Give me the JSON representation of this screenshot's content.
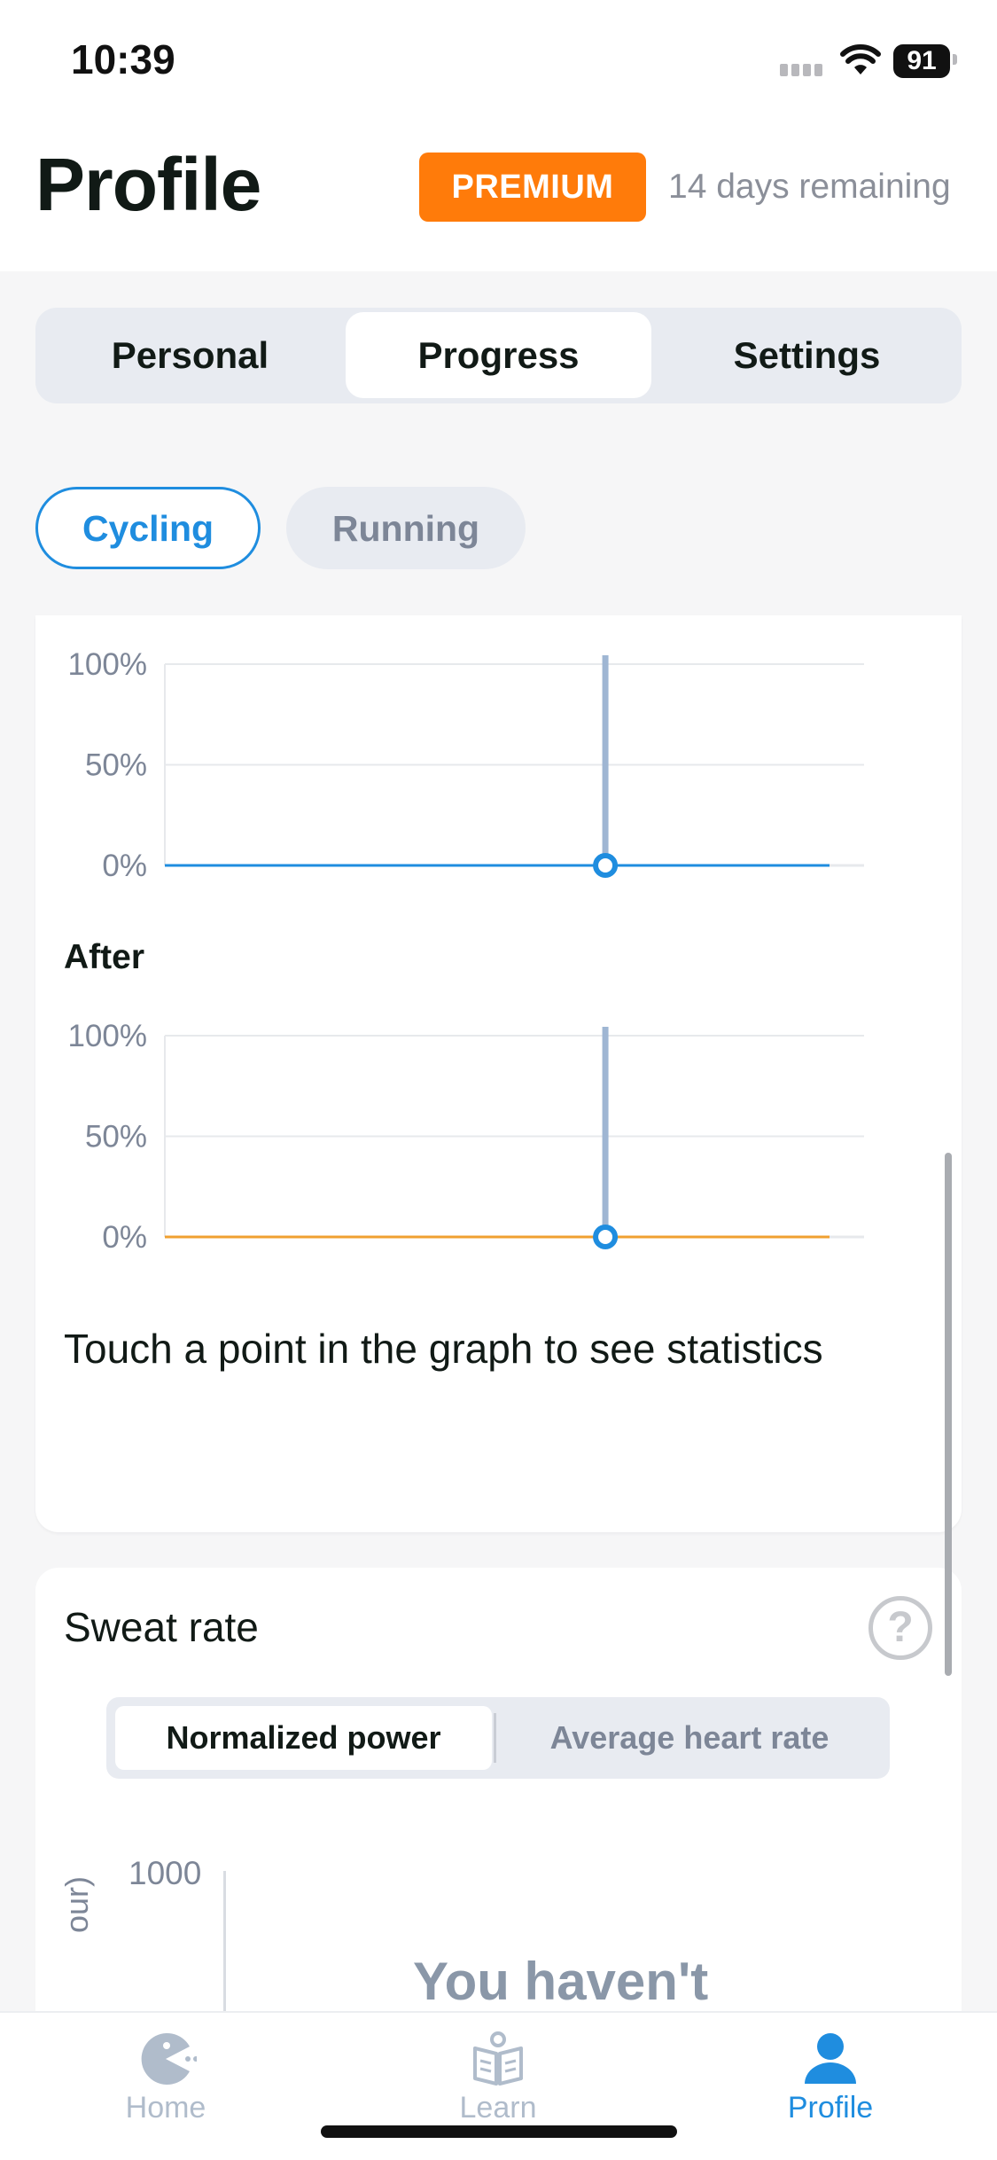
{
  "status_bar": {
    "time": "10:39",
    "battery": "91"
  },
  "header": {
    "title": "Profile",
    "badge": "PREMIUM",
    "remaining": "14 days remaining"
  },
  "tabs": [
    {
      "label": "Personal",
      "active": false
    },
    {
      "label": "Progress",
      "active": true
    },
    {
      "label": "Settings",
      "active": false
    }
  ],
  "sports": [
    {
      "label": "Cycling",
      "active": true
    },
    {
      "label": "Running",
      "active": false
    }
  ],
  "chart_data": [
    {
      "type": "line",
      "title": "",
      "y_ticks": [
        "100%",
        "50%",
        "0%"
      ],
      "ylim": [
        0,
        100
      ],
      "color": "#1f8ddf",
      "values": [
        0,
        0
      ],
      "selected_fraction": 0.63
    },
    {
      "type": "line",
      "title": "After",
      "y_ticks": [
        "100%",
        "50%",
        "0%"
      ],
      "ylim": [
        0,
        100
      ],
      "color": "#f0a030",
      "values": [
        0,
        0
      ],
      "selected_fraction": 0.63
    }
  ],
  "touch_hint": "Touch a point in the graph to see statistics",
  "sweat_rate": {
    "title": "Sweat rate",
    "help_icon": "?",
    "metric_options": [
      "Normalized power",
      "Average heart rate"
    ],
    "y_tick": "1000",
    "y_label_fragment": "our)",
    "empty_message": "You haven't"
  },
  "bottom_nav": [
    {
      "label": "Home",
      "icon": "pacman-icon",
      "active": false
    },
    {
      "label": "Learn",
      "icon": "book-icon",
      "active": false
    },
    {
      "label": "Profile",
      "icon": "person-icon",
      "active": true
    }
  ],
  "colors": {
    "accent": "#1f8ddf",
    "premium": "#ff7b0a",
    "after_series": "#f0a030",
    "inactive": "#b0bccb"
  }
}
